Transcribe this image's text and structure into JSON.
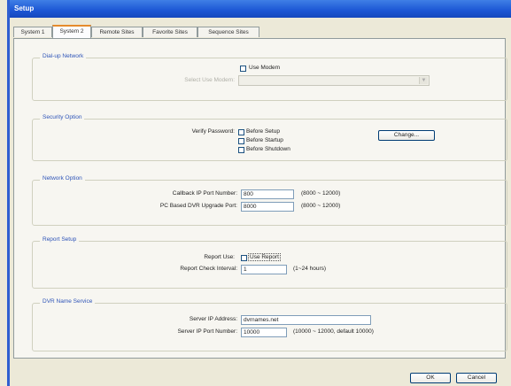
{
  "window": {
    "title": "Setup"
  },
  "tabs": [
    {
      "label": "System 1"
    },
    {
      "label": "System 2"
    },
    {
      "label": "Remote Sites"
    },
    {
      "label": "Favorite Sites"
    },
    {
      "label": "Sequence Sites"
    }
  ],
  "active_tab": "System 2",
  "dialup": {
    "legend": "Dial-up Network",
    "use_modem_label": "Use Modem",
    "use_modem_checked": false,
    "select_modem_label": "Select Use Modem:",
    "select_modem_value": ""
  },
  "security": {
    "legend": "Security Option",
    "verify_label": "Verify Password:",
    "options": [
      {
        "label": "Before Setup",
        "checked": false
      },
      {
        "label": "Before Startup",
        "checked": false
      },
      {
        "label": "Before Shutdown",
        "checked": false
      }
    ],
    "change_label": "Change..."
  },
  "network": {
    "legend": "Network Option",
    "callback_label": "Callback IP Port Number:",
    "callback_value": "800",
    "callback_range": "(8000 ~ 12000)",
    "upgrade_label": "PC Based DVR Upgrade Port:",
    "upgrade_value": "8000",
    "upgrade_range": "(8000 ~ 12000)"
  },
  "report": {
    "legend": "Report Setup",
    "use_label": "Report Use:",
    "use_report_label": "Use Report",
    "use_report_checked": false,
    "interval_label": "Report Check Interval:",
    "interval_value": "1",
    "interval_range": "(1~24 hours)"
  },
  "dvr": {
    "legend": "DVR Name Service",
    "server_ip_label": "Server IP Address:",
    "server_ip_value": "dvrnames.net",
    "server_port_label": "Server IP Port Number:",
    "server_port_value": "10000",
    "server_port_range": "(10000 ~ 12000, default 10000)"
  },
  "buttons": {
    "ok": "OK",
    "cancel": "Cancel"
  }
}
